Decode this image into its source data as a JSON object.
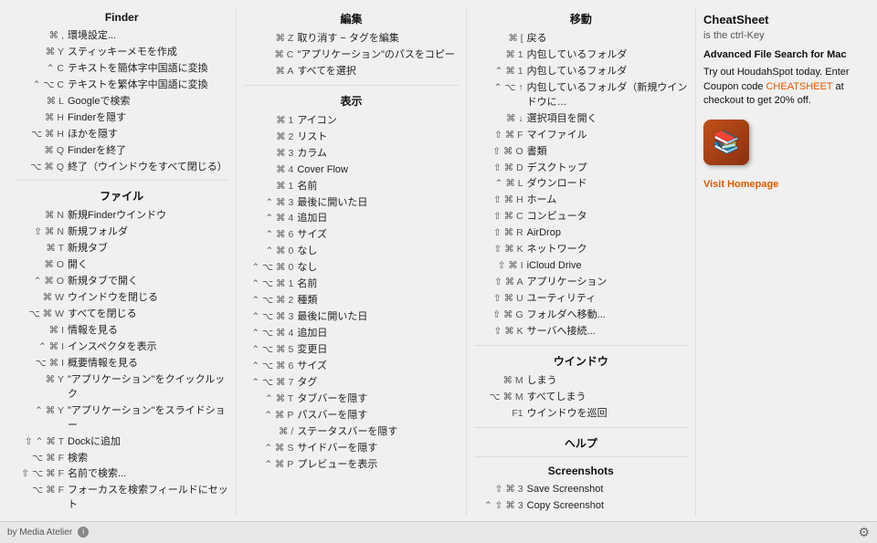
{
  "bottomBar": {
    "credit": "by Media Atelier",
    "gearLabel": "Settings"
  },
  "adPanel": {
    "appName": "CheatSheet",
    "ctrlKeyNote": "is the ctrl-Key",
    "adTitle": "Advanced File Search for Mac",
    "adBody": "Try out HoudahSpot today. Enter Coupon code ",
    "couponCode": "CHEATSHEET",
    "adBodySuffix": " at checkout to get 20% off.",
    "visitLabel": "Visit Homepage"
  },
  "columns": {
    "finder": {
      "title": "Finder",
      "sections": [
        {
          "items": [
            {
              "keys": "⌘ ,",
              "label": "環境設定..."
            },
            {
              "keys": "⌘ Y",
              "label": "スティッキーメモを作成"
            },
            {
              "keys": "⌃ C",
              "label": "テキストを簡体字中国語に変換"
            },
            {
              "keys": "⌃ ⌥ C",
              "label": "テキストを繁体字中国語に変換"
            },
            {
              "keys": "⌘ L",
              "label": "Googleで検索"
            },
            {
              "keys": "⌘ H",
              "label": "Finderを隠す"
            },
            {
              "keys": "⌥ ⌘ H",
              "label": "ほかを隠す"
            },
            {
              "keys": "⌘ Q",
              "label": "Finderを終了"
            },
            {
              "keys": "⌥ ⌘ Q",
              "label": "終了（ウインドウをすべて閉じる）"
            }
          ]
        },
        {
          "title": "ファイル",
          "items": [
            {
              "keys": "⌘ N",
              "label": "新規Finderウインドウ"
            },
            {
              "keys": "⇧ ⌘ N",
              "label": "新規フォルダ"
            },
            {
              "keys": "⌘ T",
              "label": "新規タブ"
            },
            {
              "keys": "⌘ O",
              "label": "開く"
            },
            {
              "keys": "⌃ ⌘ O",
              "label": "新規タブで開く"
            },
            {
              "keys": "⌘ W",
              "label": "ウインドウを閉じる"
            },
            {
              "keys": "⌥ ⌘ W",
              "label": "すべてを閉じる"
            },
            {
              "keys": "⌘ I",
              "label": "情報を見る"
            },
            {
              "keys": "⌃ ⌘ I",
              "label": "インスペクタを表示"
            },
            {
              "keys": "⌥ ⌘ I",
              "label": "概要情報を見る"
            },
            {
              "keys": "⌘ Y",
              "label": "\"アプリケーション\"をクイックルック"
            },
            {
              "keys": "⌃ ⌘ Y",
              "label": "\"アプリケーション\"をスライドショー"
            },
            {
              "keys": "⇧ ⌃ ⌘ T",
              "label": "Dockに追加"
            },
            {
              "keys": "⌥ ⌘ F",
              "label": "検索"
            },
            {
              "keys": "⇧ ⌥ ⌘ F",
              "label": "名前で検索..."
            },
            {
              "keys": "⌥ ⌘ F",
              "label": "フォーカスを検索フィールドにセット"
            }
          ]
        }
      ]
    },
    "edit": {
      "title": "編集",
      "sections": [
        {
          "items": [
            {
              "keys": "⌘ Z",
              "label": "取り消す − タグを編集"
            },
            {
              "keys": "⌘ C",
              "label": "\"アプリケーション\"のパスをコピー"
            },
            {
              "keys": "⌘ A",
              "label": "すべてを選択"
            }
          ]
        },
        {
          "title": "表示",
          "items": [
            {
              "keys": "⌘ 1",
              "label": "アイコン"
            },
            {
              "keys": "⌘ 2",
              "label": "リスト"
            },
            {
              "keys": "⌘ 3",
              "label": "カラム"
            },
            {
              "keys": "⌘ 4",
              "label": "Cover Flow"
            },
            {
              "keys": "⌘ 1",
              "label": "名前"
            },
            {
              "keys": "⌃ ⌘ 3",
              "label": "最後に開いた日"
            },
            {
              "keys": "⌃ ⌘ 4",
              "label": "追加日"
            },
            {
              "keys": "⌃ ⌘ 6",
              "label": "サイズ"
            },
            {
              "keys": "⌃ ⌘ 0",
              "label": "なし"
            },
            {
              "keys": "⌃ ⌥ ⌘ 0",
              "label": "なし"
            },
            {
              "keys": "⌃ ⌥ ⌘ 1",
              "label": "名前"
            },
            {
              "keys": "⌃ ⌥ ⌘ 2",
              "label": "種類"
            },
            {
              "keys": "⌃ ⌥ ⌘ 3",
              "label": "最後に開いた日"
            },
            {
              "keys": "⌃ ⌥ ⌘ 4",
              "label": "追加日"
            },
            {
              "keys": "⌃ ⌥ ⌘ 5",
              "label": "変更日"
            },
            {
              "keys": "⌃ ⌥ ⌘ 6",
              "label": "サイズ"
            },
            {
              "keys": "⌃ ⌥ ⌘ 7",
              "label": "タグ"
            },
            {
              "keys": "⌃ ⌘ T",
              "label": "タブバーを隠す"
            },
            {
              "keys": "⌃ ⌘ P",
              "label": "パスバーを隠す"
            },
            {
              "keys": "⌘ /",
              "label": "ステータスバーを隠す"
            },
            {
              "keys": "⌃ ⌘ S",
              "label": "サイドバーを隠す"
            },
            {
              "keys": "⌃ ⌘ P",
              "label": "プレビューを表示"
            }
          ]
        }
      ]
    },
    "move": {
      "title": "移動",
      "sections": [
        {
          "items": [
            {
              "keys": "⌘ [",
              "label": "戻る"
            },
            {
              "keys": "⌘ 1",
              "label": "内包しているフォルダ"
            },
            {
              "keys": "⌃ ⌘ 1",
              "label": "内包しているフォルダ"
            },
            {
              "keys": "⌃ ⌥ ↑",
              "label": "内包しているフォルダ（新規ウインドウに…"
            },
            {
              "keys": "⌘ ↓",
              "label": "選択項目を開く"
            },
            {
              "keys": "⇧ ⌘ F",
              "label": "マイファイル"
            },
            {
              "keys": "⇧ ⌘ O",
              "label": "書類"
            },
            {
              "keys": "⇧ ⌘ D",
              "label": "デスクトップ"
            },
            {
              "keys": "⌃ ⌘ L",
              "label": "ダウンロード"
            },
            {
              "keys": "⇧ ⌘ H",
              "label": "ホーム"
            },
            {
              "keys": "⇧ ⌘ C",
              "label": "コンピュータ"
            },
            {
              "keys": "⇧ ⌘ R",
              "label": "AirDrop"
            },
            {
              "keys": "⇧ ⌘ K",
              "label": "ネットワーク"
            },
            {
              "keys": "⇧ ⌘ I",
              "label": "iCloud Drive"
            },
            {
              "keys": "⇧ ⌘ A",
              "label": "アプリケーション"
            },
            {
              "keys": "⇧ ⌘ U",
              "label": "ユーティリティ"
            },
            {
              "keys": "⇧ ⌘ G",
              "label": "フォルダへ移動..."
            },
            {
              "keys": "⇧ ⌘ K",
              "label": "サーバへ接続..."
            }
          ]
        },
        {
          "title": "ウインドウ",
          "items": [
            {
              "keys": "⌘ M",
              "label": "しまう"
            },
            {
              "keys": "⌥ ⌘ M",
              "label": "すべてしまう"
            },
            {
              "keys": "F1",
              "label": "ウインドウを巡回"
            }
          ]
        },
        {
          "title": "ヘルプ",
          "items": []
        },
        {
          "title": "Screenshots",
          "items": [
            {
              "keys": "⇧ ⌘ 3",
              "label": "Save Screenshot"
            },
            {
              "keys": "⌃ ⇧ ⌘ 3",
              "label": "Copy Screenshot"
            }
          ]
        }
      ]
    }
  }
}
